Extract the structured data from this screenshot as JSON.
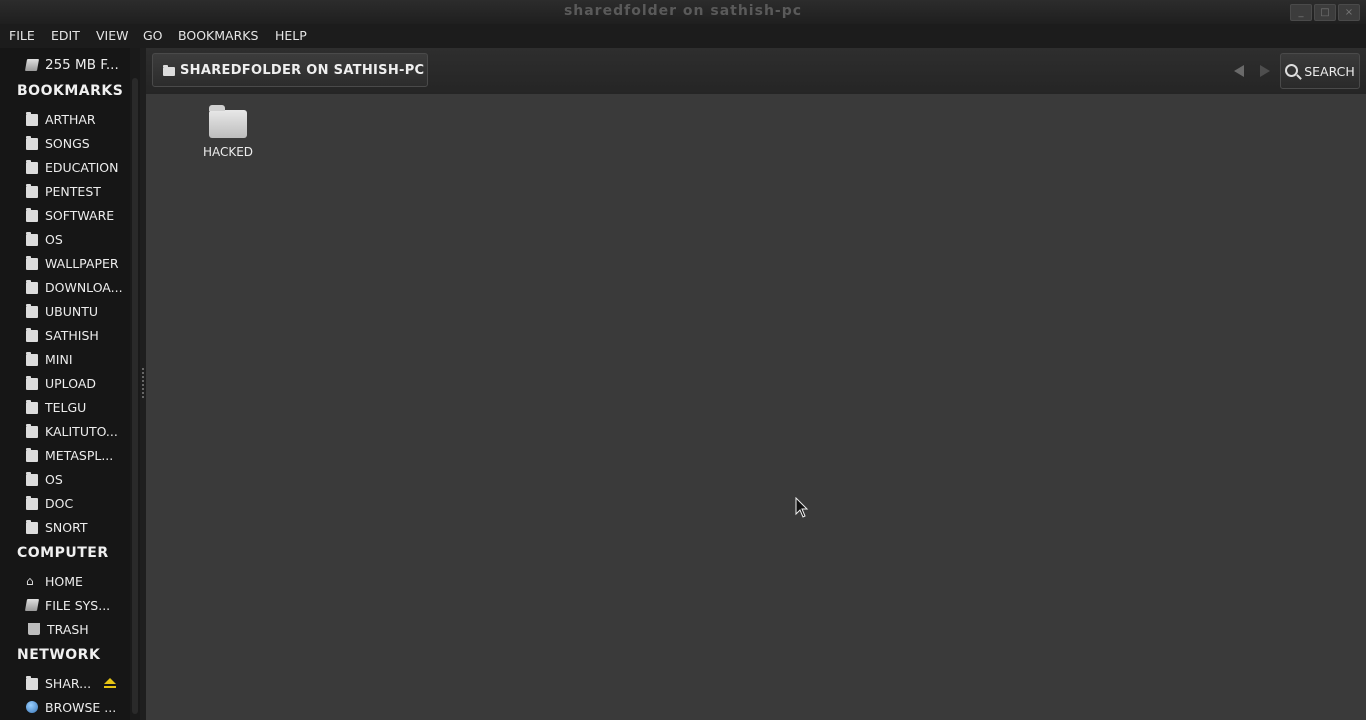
{
  "window": {
    "title": "sharedfolder on sathish-pc",
    "controls": [
      "_",
      "□",
      "×"
    ]
  },
  "menubar": {
    "items": [
      "File",
      "Edit",
      "View",
      "Go",
      "Bookmarks",
      "Help"
    ]
  },
  "sidebar": {
    "device": "255 MB F...",
    "bookmarks_heading": "Bookmarks",
    "bookmarks": [
      "arthar",
      "songs",
      "education",
      "pentest",
      "software",
      "os",
      "wallpaper",
      "downloa...",
      "ubuntu",
      "sathish",
      "mini",
      "upload",
      "telgu",
      "kalituto...",
      "metaspl...",
      "os",
      "doc",
      "snort"
    ],
    "computer_heading": "Computer",
    "computer": [
      {
        "label": "Home",
        "icon": "home-icon"
      },
      {
        "label": "File Sys...",
        "icon": "drive-icon"
      },
      {
        "label": "Trash",
        "icon": "trash-icon"
      }
    ],
    "network_heading": "Network",
    "network": [
      {
        "label": "shar...",
        "icon": "folder-icon"
      },
      {
        "label": "Browse ...",
        "icon": "globe-icon"
      }
    ]
  },
  "toolbar": {
    "path_label": "sharedfolder on sathish-pc",
    "search_label": "Search"
  },
  "content": {
    "files": [
      {
        "name": "hacked",
        "icon": "folder-icon"
      }
    ]
  }
}
